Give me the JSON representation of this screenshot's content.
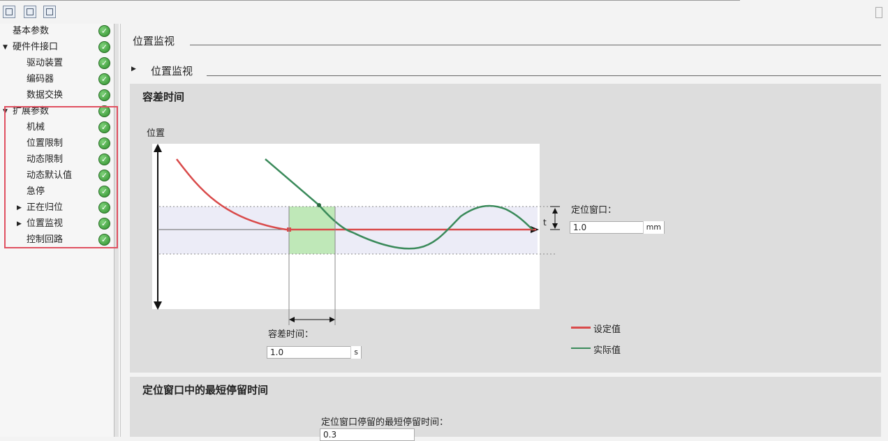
{
  "toolbar": {
    "icons": [
      "function-view-icon",
      "tree-view-icon",
      "param-view-icon"
    ]
  },
  "sidebar": {
    "items": [
      {
        "label": "基本参数",
        "level": 0,
        "arrow": "",
        "status": "ok"
      },
      {
        "label": "硬件件接口",
        "level": 0,
        "arrow": "▼",
        "status": "ok"
      },
      {
        "label": "驱动装置",
        "level": 1,
        "arrow": "",
        "status": "ok"
      },
      {
        "label": "编码器",
        "level": 1,
        "arrow": "",
        "status": "ok"
      },
      {
        "label": "数据交换",
        "level": 1,
        "arrow": "",
        "status": "ok"
      },
      {
        "label": "扩展参数",
        "level": 0,
        "arrow": "▼",
        "status": "ok"
      },
      {
        "label": "机械",
        "level": 1,
        "arrow": "",
        "status": "ok"
      },
      {
        "label": "位置限制",
        "level": 1,
        "arrow": "",
        "status": "ok"
      },
      {
        "label": "动态限制",
        "level": 1,
        "arrow": "",
        "status": "ok"
      },
      {
        "label": "动态默认值",
        "level": 1,
        "arrow": "",
        "status": "ok"
      },
      {
        "label": "急停",
        "level": 1,
        "arrow": "",
        "status": "ok"
      },
      {
        "label": "正在归位",
        "level": 1,
        "arrow": "▶",
        "status": "ok"
      },
      {
        "label": "位置监视",
        "level": 1,
        "arrow": "▶",
        "status": "ok"
      },
      {
        "label": "控制回路",
        "level": 1,
        "arrow": "",
        "status": "ok"
      }
    ]
  },
  "main": {
    "header": "位置监视",
    "subheader": "位置监视",
    "panel1": {
      "title": "容差时间",
      "y_axis_label": "位置",
      "window_label": "定位窗口：",
      "window_value": "1.0",
      "window_unit": "mm",
      "t_marker": "t",
      "tolerance_label": "容差时间：",
      "tolerance_value": "1.0",
      "tolerance_unit": "s",
      "legend": [
        {
          "label": "设定值",
          "color": "#d94a4a"
        },
        {
          "label": "实际值",
          "color": "#3a8a5a"
        }
      ]
    },
    "panel2": {
      "title": "定位窗口中的最短停留时间",
      "field_label": "定位窗口停留的最短停留时间：",
      "field_value": "0.3"
    }
  }
}
